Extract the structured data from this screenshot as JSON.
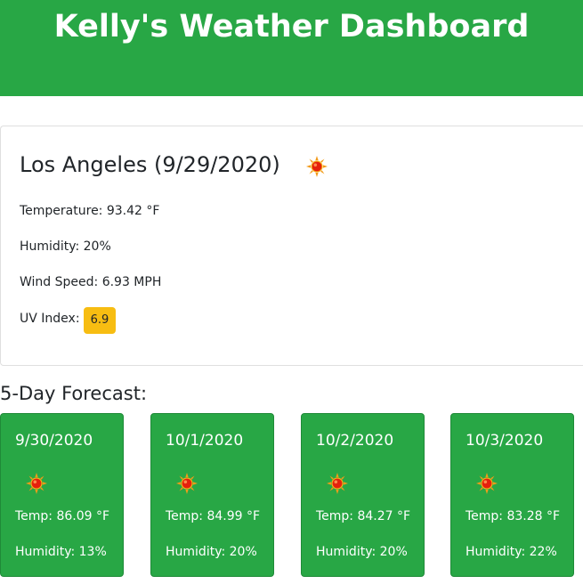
{
  "header": {
    "title": "Kelly's Weather Dashboard"
  },
  "current": {
    "heading": "Los Angeles (9/29/2020)",
    "icon": "sun-icon",
    "temperature": "Temperature: 93.42 °F",
    "humidity": "Humidity: 20%",
    "wind": "Wind Speed: 6.93 MPH",
    "uv_label": "UV Index:",
    "uv_value": "6.9"
  },
  "forecast": {
    "title": "5-Day Forecast:",
    "days": [
      {
        "date": "9/30/2020",
        "icon": "sun-icon",
        "temp": "Temp: 86.09 °F",
        "humidity": "Humidity: 13%"
      },
      {
        "date": "10/1/2020",
        "icon": "sun-icon",
        "temp": "Temp: 84.99 °F",
        "humidity": "Humidity: 20%"
      },
      {
        "date": "10/2/2020",
        "icon": "sun-icon",
        "temp": "Temp: 84.27 °F",
        "humidity": "Humidity: 20%"
      },
      {
        "date": "10/3/2020",
        "icon": "sun-icon",
        "temp": "Temp: 83.28 °F",
        "humidity": "Humidity: 22%"
      }
    ]
  },
  "colors": {
    "header_bg": "#28a745",
    "card_bg": "#28a745",
    "uv_badge": "#f7bd12"
  }
}
